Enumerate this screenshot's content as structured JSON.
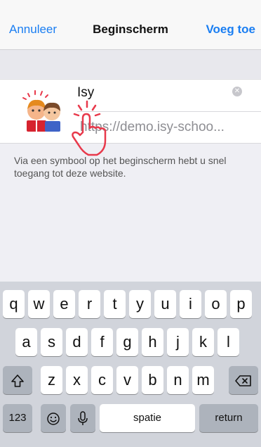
{
  "navbar": {
    "cancel": "Annuleer",
    "title": "Beginscherm",
    "add": "Voeg toe"
  },
  "bookmark": {
    "name": "Isy",
    "url": "https://demo.isy-schoo...",
    "hint": "Via een symbool op het beginscherm hebt u snel toegang tot deze website."
  },
  "keyboard": {
    "row1": [
      "q",
      "w",
      "e",
      "r",
      "t",
      "y",
      "u",
      "i",
      "o",
      "p"
    ],
    "row2": [
      "a",
      "s",
      "d",
      "f",
      "g",
      "h",
      "j",
      "k",
      "l"
    ],
    "row3": [
      "z",
      "x",
      "c",
      "v",
      "b",
      "n",
      "m"
    ],
    "shift_icon": "shift-icon",
    "delete_icon": "backspace-icon",
    "numbers": "123",
    "emoji_icon": "emoji-icon",
    "mic_icon": "microphone-icon",
    "space": "spatie",
    "return": "return"
  },
  "colors": {
    "accent": "#1a7ef2",
    "pointer": "#e8394b"
  }
}
